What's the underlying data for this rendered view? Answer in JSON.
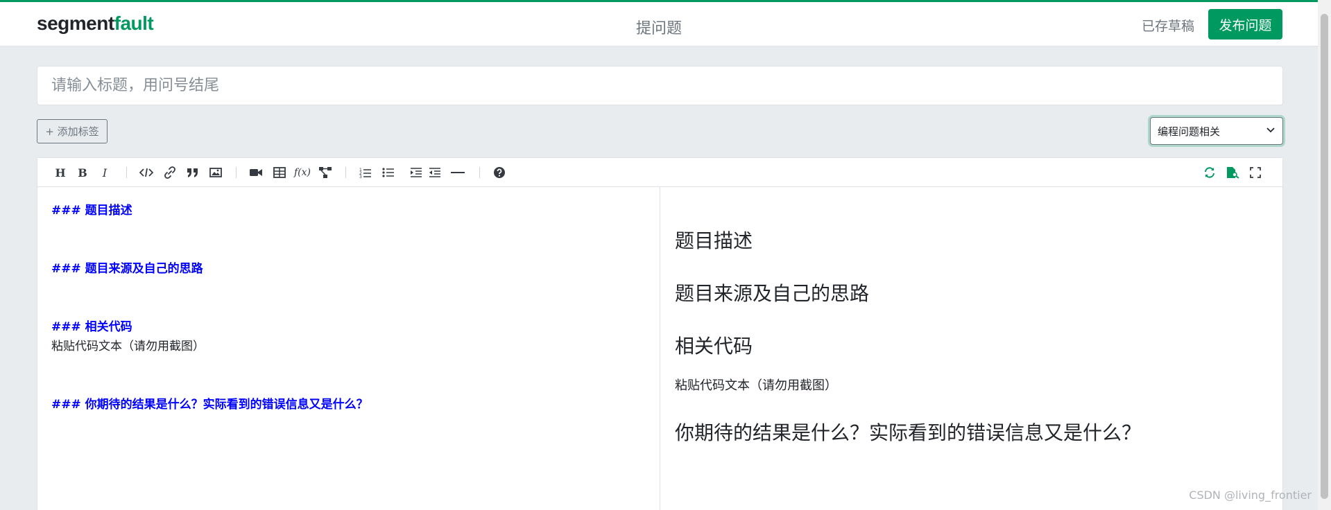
{
  "header": {
    "logo_main": "segment",
    "logo_accent": "fault",
    "page_title": "提问题",
    "draft_label": "已存草稿",
    "publish_label": "发布问题"
  },
  "form": {
    "title_placeholder": "请输入标题，用问号结尾",
    "add_tag_label": "+ 添加标签",
    "category_value": "编程问题相关"
  },
  "toolbar": {
    "left_icons": [
      "heading-icon",
      "bold-icon",
      "italic-icon",
      "code-icon",
      "link-icon",
      "quote-icon",
      "image-icon",
      "video-icon",
      "table-icon",
      "formula-icon",
      "diagram-icon",
      "ordered-list-icon",
      "unordered-list-icon",
      "indent-icon",
      "outdent-icon",
      "horizontal-rule-icon",
      "help-icon"
    ],
    "right_icons": [
      "sync-scroll-icon",
      "preview-icon",
      "fullscreen-icon"
    ],
    "bold_glyph": "B",
    "italic_glyph": "I",
    "heading_glyph": "H",
    "formula_glyph": "f(x)",
    "accent_color": "#009a61"
  },
  "editor": {
    "markdown_lines": [
      {
        "text": "###  题目描述",
        "kind": "heading"
      },
      {
        "text": "",
        "kind": "blank"
      },
      {
        "text": "",
        "kind": "blank"
      },
      {
        "text": "###  题目来源及自己的思路",
        "kind": "heading"
      },
      {
        "text": "",
        "kind": "blank"
      },
      {
        "text": "",
        "kind": "blank"
      },
      {
        "text": "###  相关代码",
        "kind": "heading"
      },
      {
        "text": "粘贴代码文本（请勿用截图）",
        "kind": "text"
      },
      {
        "text": "",
        "kind": "blank"
      },
      {
        "text": "",
        "kind": "blank"
      },
      {
        "text": "###  你期待的结果是什么？实际看到的错误信息又是什么？",
        "kind": "heading"
      }
    ]
  },
  "preview": {
    "h1": "题目描述",
    "h2": "题目来源及自己的思路",
    "h3": "相关代码",
    "p1": "粘贴代码文本（请勿用截图）",
    "h4": "你期待的结果是什么？实际看到的错误信息又是什么？"
  },
  "watermark": "CSDN @living_frontier"
}
